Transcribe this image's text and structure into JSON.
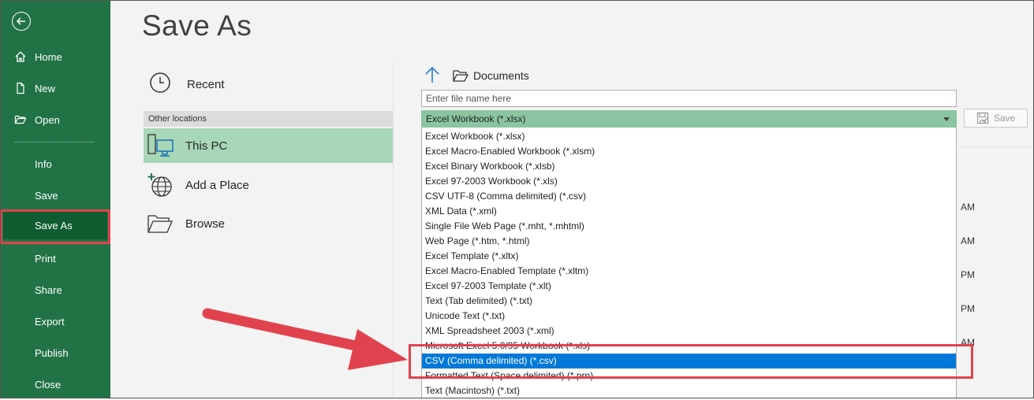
{
  "sidebar": {
    "back_label": "Back",
    "items": [
      {
        "label": "Home",
        "icon": "home-icon"
      },
      {
        "label": "New",
        "icon": "new-document-icon"
      },
      {
        "label": "Open",
        "icon": "open-folder-icon"
      },
      {
        "label": "Info"
      },
      {
        "label": "Save"
      },
      {
        "label": "Save As",
        "active": true
      },
      {
        "label": "Print"
      },
      {
        "label": "Share"
      },
      {
        "label": "Export"
      },
      {
        "label": "Publish"
      },
      {
        "label": "Close"
      }
    ]
  },
  "page": {
    "title": "Save As"
  },
  "locations": {
    "recent": "Recent",
    "other_header": "Other locations",
    "this_pc": "This PC",
    "add_place": "Add a Place",
    "browse": "Browse"
  },
  "browser": {
    "path": "Documents",
    "filename_placeholder": "Enter file name here",
    "selected_type": "Excel Workbook (*.xlsx)",
    "save_label": "Save"
  },
  "file_types": [
    "Excel Workbook (*.xlsx)",
    "Excel Macro-Enabled Workbook (*.xlsm)",
    "Excel Binary Workbook (*.xlsb)",
    "Excel 97-2003 Workbook (*.xls)",
    "CSV UTF-8 (Comma delimited) (*.csv)",
    "XML Data (*.xml)",
    "Single File Web Page (*.mht, *.mhtml)",
    "Web Page (*.htm, *.html)",
    "Excel Template (*.xltx)",
    "Excel Macro-Enabled Template (*.xltm)",
    "Excel 97-2003 Template (*.xlt)",
    "Text (Tab delimited) (*.txt)",
    "Unicode Text (*.txt)",
    "XML Spreadsheet 2003 (*.xml)",
    "Microsoft Excel 5.0/95 Workbook (*.xls)",
    "CSV (Comma delimited) (*.csv)",
    "Formatted Text (Space delimited) (*.prn)",
    "Text (Macintosh) (*.txt)"
  ],
  "highlighted_type_index": 15,
  "times": [
    "AM",
    "AM",
    "PM",
    "PM",
    "AM"
  ],
  "colors": {
    "sidebar": "#217346",
    "active_nav": "#0e5c2f",
    "selected_location": "#a7d7b7",
    "selected_option": "#0078d7",
    "callout": "#e0434d"
  }
}
